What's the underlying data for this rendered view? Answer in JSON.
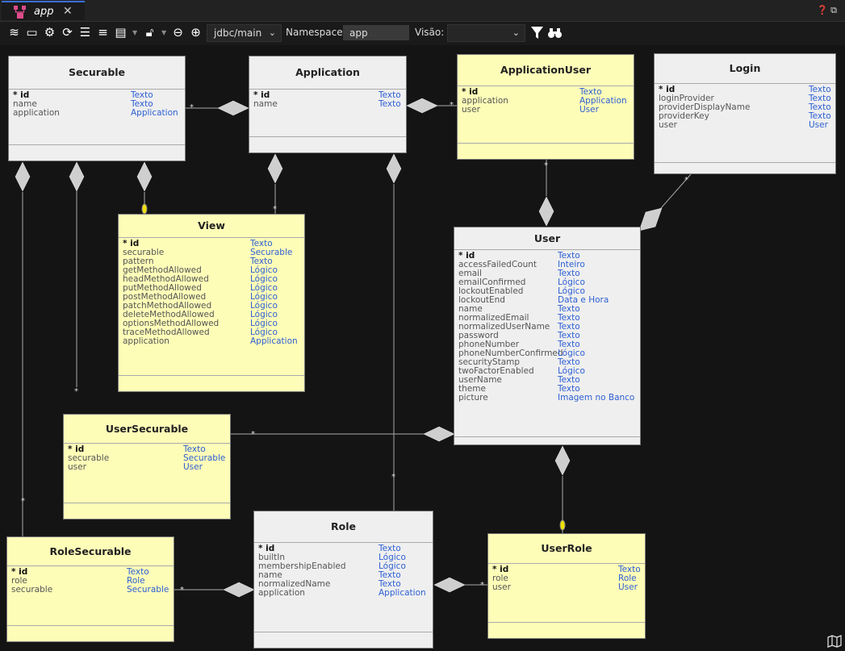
{
  "tab": {
    "title": "app",
    "close": "✕"
  },
  "toolbar": {
    "connection": "jdbc/main",
    "namespace_label": "Namespace",
    "namespace_value": "app",
    "view_label": "Visão:",
    "view_value": ""
  },
  "entities": {
    "securable": {
      "name": "Securable",
      "attrs": [
        {
          "n": "* id",
          "t": "Texto"
        },
        {
          "n": "name",
          "t": "Texto"
        },
        {
          "n": "application",
          "t": "Application"
        }
      ]
    },
    "application": {
      "name": "Application",
      "attrs": [
        {
          "n": "* id",
          "t": "Texto"
        },
        {
          "n": "name",
          "t": "Texto"
        }
      ]
    },
    "applicationuser": {
      "name": "ApplicationUser",
      "attrs": [
        {
          "n": "* id",
          "t": "Texto"
        },
        {
          "n": "application",
          "t": "Application"
        },
        {
          "n": "user",
          "t": "User"
        }
      ]
    },
    "login": {
      "name": "Login",
      "attrs": [
        {
          "n": "* id",
          "t": "Texto"
        },
        {
          "n": "loginProvider",
          "t": "Texto"
        },
        {
          "n": "providerDisplayName",
          "t": "Texto"
        },
        {
          "n": "providerKey",
          "t": "Texto"
        },
        {
          "n": "user",
          "t": "User"
        }
      ]
    },
    "view": {
      "name": "View",
      "attrs": [
        {
          "n": "* id",
          "t": "Texto"
        },
        {
          "n": "securable",
          "t": "Securable"
        },
        {
          "n": "pattern",
          "t": "Texto"
        },
        {
          "n": "getMethodAllowed",
          "t": "Lógico"
        },
        {
          "n": "headMethodAllowed",
          "t": "Lógico"
        },
        {
          "n": "putMethodAllowed",
          "t": "Lógico"
        },
        {
          "n": "postMethodAllowed",
          "t": "Lógico"
        },
        {
          "n": "patchMethodAllowed",
          "t": "Lógico"
        },
        {
          "n": "deleteMethodAllowed",
          "t": "Lógico"
        },
        {
          "n": "optionsMethodAllowed",
          "t": "Lógico"
        },
        {
          "n": "traceMethodAllowed",
          "t": "Lógico"
        },
        {
          "n": "application",
          "t": "Application"
        }
      ]
    },
    "user": {
      "name": "User",
      "attrs": [
        {
          "n": "* id",
          "t": "Texto"
        },
        {
          "n": "accessFailedCount",
          "t": "Inteiro"
        },
        {
          "n": "email",
          "t": "Texto"
        },
        {
          "n": "emailConfirmed",
          "t": "Lógico"
        },
        {
          "n": "lockoutEnabled",
          "t": "Lógico"
        },
        {
          "n": "lockoutEnd",
          "t": "Data e Hora"
        },
        {
          "n": "name",
          "t": "Texto"
        },
        {
          "n": "normalizedEmail",
          "t": "Texto"
        },
        {
          "n": "normalizedUserName",
          "t": "Texto"
        },
        {
          "n": "password",
          "t": "Texto"
        },
        {
          "n": "phoneNumber",
          "t": "Texto"
        },
        {
          "n": "phoneNumberConfirmed",
          "t": "Lógico"
        },
        {
          "n": "securityStamp",
          "t": "Texto"
        },
        {
          "n": "twoFactorEnabled",
          "t": "Lógico"
        },
        {
          "n": "userName",
          "t": "Texto"
        },
        {
          "n": "theme",
          "t": "Texto"
        },
        {
          "n": "picture",
          "t": "Imagem no Banco"
        }
      ]
    },
    "usersecurable": {
      "name": "UserSecurable",
      "attrs": [
        {
          "n": "* id",
          "t": "Texto"
        },
        {
          "n": "securable",
          "t": "Securable"
        },
        {
          "n": "user",
          "t": "User"
        }
      ]
    },
    "rolesecurable": {
      "name": "RoleSecurable",
      "attrs": [
        {
          "n": "* id",
          "t": "Texto"
        },
        {
          "n": "role",
          "t": "Role"
        },
        {
          "n": "securable",
          "t": "Securable"
        }
      ]
    },
    "role": {
      "name": "Role",
      "attrs": [
        {
          "n": "* id",
          "t": "Texto"
        },
        {
          "n": "builtIn",
          "t": "Lógico"
        },
        {
          "n": "membershipEnabled",
          "t": "Lógico"
        },
        {
          "n": "name",
          "t": "Texto"
        },
        {
          "n": "normalizedName",
          "t": "Texto"
        },
        {
          "n": "application",
          "t": "Application"
        }
      ]
    },
    "userrole": {
      "name": "UserRole",
      "attrs": [
        {
          "n": "* id",
          "t": "Texto"
        },
        {
          "n": "role",
          "t": "Role"
        },
        {
          "n": "user",
          "t": "User"
        }
      ]
    }
  },
  "relationships": [
    {
      "from": "usersecurable",
      "to": "securable",
      "label": "*"
    },
    {
      "from": "rolesecurable",
      "to": "securable",
      "label": "*"
    },
    {
      "from": "view",
      "to": "securable",
      "label": ""
    },
    {
      "from": "securable",
      "to": "application",
      "label": "*"
    },
    {
      "from": "view",
      "to": "application",
      "label": "*"
    },
    {
      "from": "applicationuser",
      "to": "application",
      "label": "*"
    },
    {
      "from": "role",
      "to": "application",
      "label": "*"
    },
    {
      "from": "applicationuser",
      "to": "user",
      "label": "*"
    },
    {
      "from": "login",
      "to": "user",
      "label": "*"
    },
    {
      "from": "usersecurable",
      "to": "user",
      "label": "*"
    },
    {
      "from": "userrole",
      "to": "user",
      "label": ""
    },
    {
      "from": "rolesecurable",
      "to": "role",
      "label": "*"
    },
    {
      "from": "userrole",
      "to": "role",
      "label": "*"
    }
  ]
}
